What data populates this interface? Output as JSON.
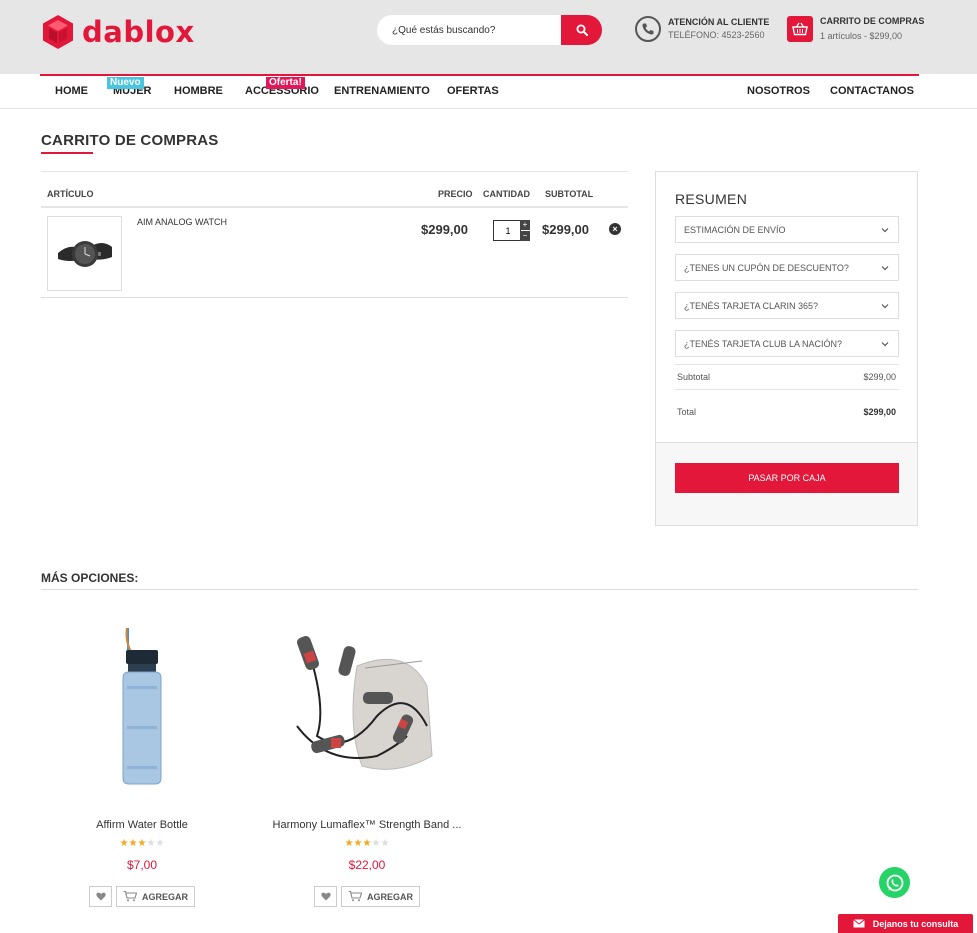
{
  "brand": {
    "name": "dablox",
    "color": "#e2173a"
  },
  "search": {
    "placeholder": "¿Qué estás buscando?",
    "icon": "search-icon"
  },
  "support": {
    "title": "ATENCIÓN AL CLIENTE",
    "phone": "TELÉFONO: 4523-2560",
    "icon": "phone-icon"
  },
  "mini_cart": {
    "title": "CARRITO DE COMPRAS",
    "summary": "1 artículos  -  $299,00",
    "icon": "basket-icon"
  },
  "nav": {
    "left": [
      {
        "label": "HOME"
      },
      {
        "label": "MUJER",
        "badge": "Nuevo"
      },
      {
        "label": "HOMBRE"
      },
      {
        "label": "ACCESSORIO",
        "badge": "Oferta!"
      },
      {
        "label": "ENTRENAMIENTO"
      },
      {
        "label": "OFERTAS"
      }
    ],
    "right": [
      {
        "label": "NOSOTROS"
      },
      {
        "label": "CONTACTANOS"
      }
    ]
  },
  "page": {
    "title": "CARRITO DE COMPRAS"
  },
  "cart": {
    "headers": {
      "item": "ARTÍCULO",
      "price": "PRECIO",
      "qty": "CANTIDAD",
      "subtotal": "SUBTOTAL"
    },
    "items": [
      {
        "name": "AIM ANALOG WATCH",
        "price": "$299,00",
        "qty": "1",
        "subtotal": "$299,00",
        "image": "watch-image"
      }
    ]
  },
  "summary": {
    "title": "RESUMEN",
    "sections": [
      {
        "label": "ESTIMACIÓN DE ENVÍO"
      },
      {
        "label": "¿TENES UN CUPÓN DE DESCUENTO?"
      },
      {
        "label": "¿TENÉS TARJETA CLARIN 365?"
      },
      {
        "label": "¿TENÉS TARJETA CLUB LA NACIÓN?"
      }
    ],
    "subtotal_label": "Subtotal",
    "subtotal_value": "$299,00",
    "total_label": "Total",
    "total_value": "$299,00",
    "checkout_label": "PASAR POR CAJA"
  },
  "more": {
    "title": "MÁS OPCIONES:",
    "products": [
      {
        "name": "Affirm Water Bottle",
        "price": "$7,00",
        "rating": 3,
        "max_rating": 5,
        "add_label": "AGREGAR",
        "image": "water-bottle-image"
      },
      {
        "name": "Harmony Lumaflex™ Strength Band ...",
        "price": "$22,00",
        "rating": 3,
        "max_rating": 5,
        "add_label": "AGREGAR",
        "image": "jump-rope-image"
      }
    ]
  },
  "chat": {
    "label": "Dejanos tu consulta",
    "whatsapp_icon": "whatsapp-icon",
    "color": "#25d366"
  }
}
